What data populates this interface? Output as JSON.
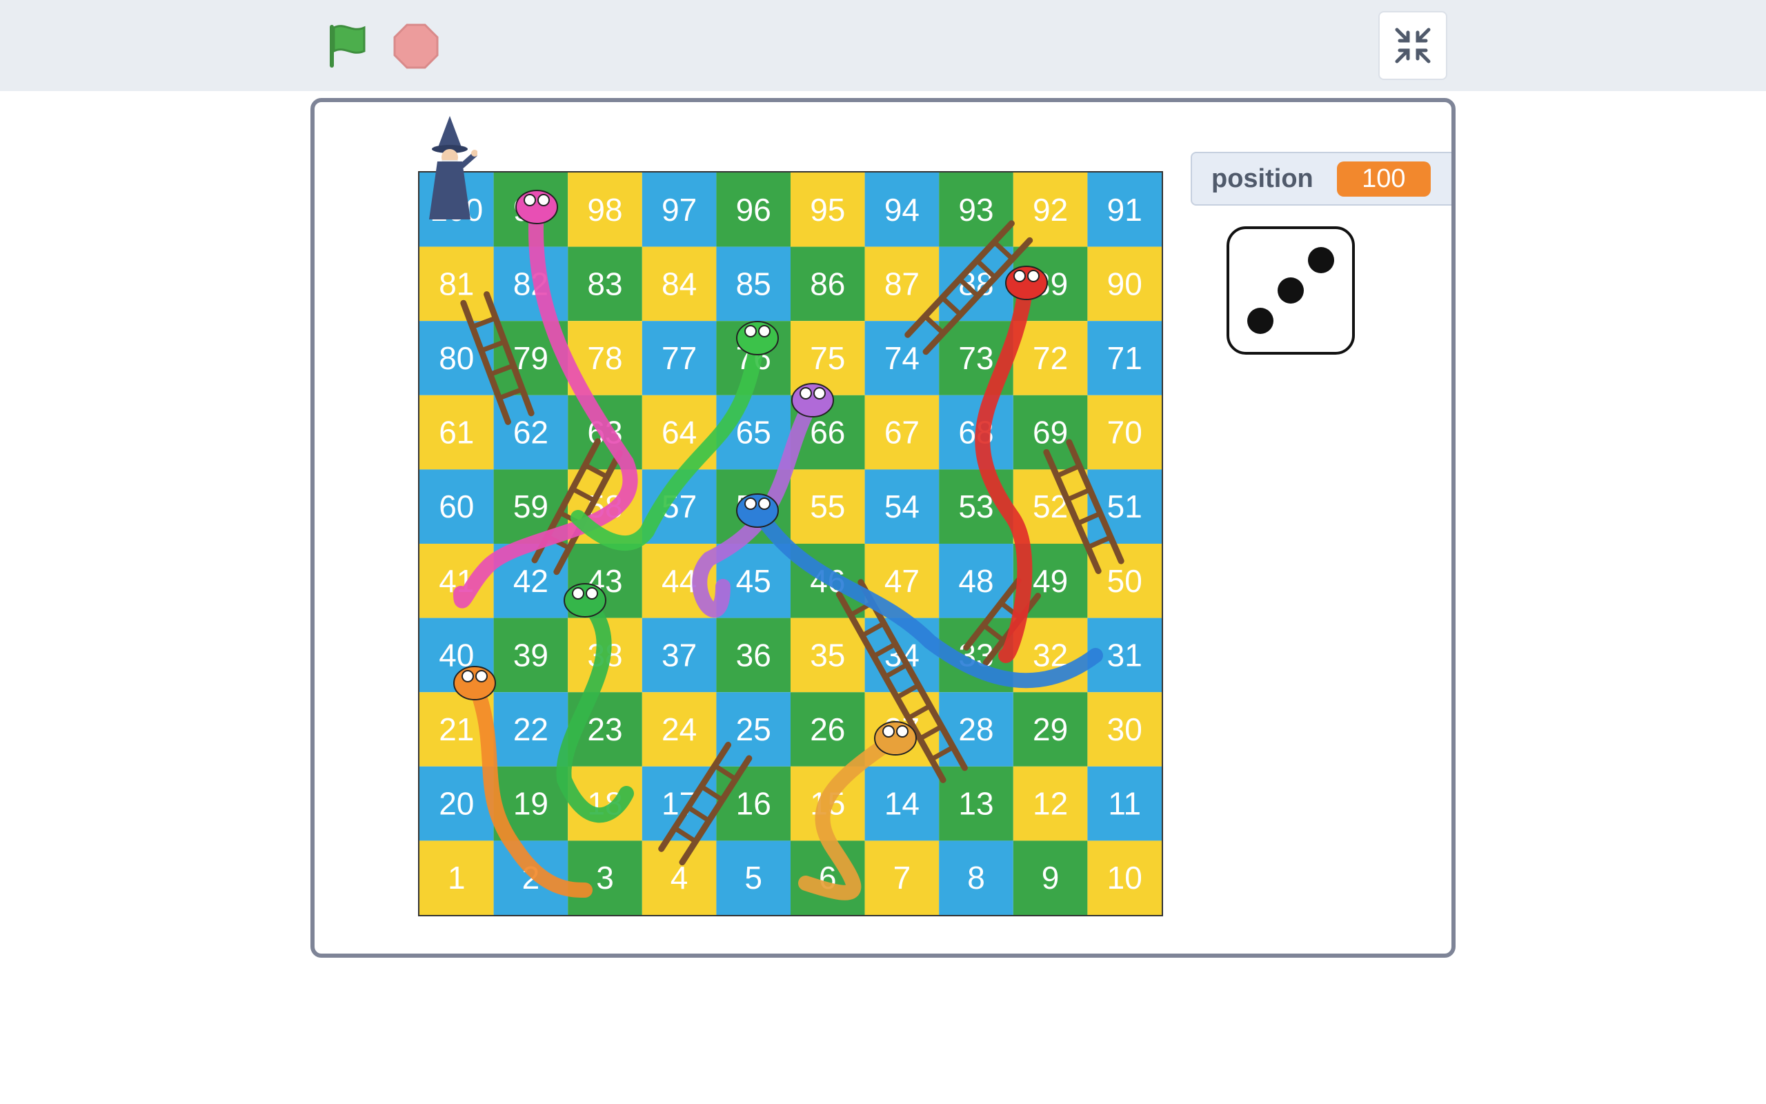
{
  "toolbar": {
    "green_flag_icon": "green-flag-icon",
    "stop_icon": "stop-sign-icon",
    "fullscreen_exit_icon": "shrink-arrows-icon",
    "flag_color": "#4cae4c",
    "stop_color": "#ec9c9c"
  },
  "stage": {
    "monitor": {
      "label": "position",
      "value": "100",
      "value_color": "#f2882d"
    },
    "dice": {
      "face": 3
    },
    "board": {
      "rows": [
        [
          "100",
          "99",
          "98",
          "97",
          "96",
          "95",
          "94",
          "93",
          "92",
          "91"
        ],
        [
          "81",
          "82",
          "83",
          "84",
          "85",
          "86",
          "87",
          "88",
          "89",
          "90"
        ],
        [
          "80",
          "79",
          "78",
          "77",
          "76",
          "75",
          "74",
          "73",
          "72",
          "71"
        ],
        [
          "61",
          "62",
          "63",
          "64",
          "65",
          "66",
          "67",
          "68",
          "69",
          "70"
        ],
        [
          "60",
          "59",
          "58",
          "57",
          "56",
          "55",
          "54",
          "53",
          "52",
          "51"
        ],
        [
          "41",
          "42",
          "43",
          "44",
          "45",
          "46",
          "47",
          "48",
          "49",
          "50"
        ],
        [
          "40",
          "39",
          "38",
          "37",
          "36",
          "35",
          "34",
          "33",
          "32",
          "31"
        ],
        [
          "21",
          "22",
          "23",
          "24",
          "25",
          "26",
          "27",
          "28",
          "29",
          "30"
        ],
        [
          "20",
          "19",
          "18",
          "17",
          "16",
          "15",
          "14",
          "13",
          "12",
          "11"
        ],
        [
          "1",
          "2",
          "3",
          "4",
          "5",
          "6",
          "7",
          "8",
          "9",
          "10"
        ]
      ],
      "palette": [
        "#37a9e1",
        "#ec6e24",
        "#3aa648",
        "#7b3fa0",
        "#f7d230",
        "#e7348c"
      ],
      "snake_colors": [
        "#e84fb4",
        "#3cc24a",
        "#b06ad8",
        "#e0302a",
        "#2d7fd8",
        "#35b64a",
        "#f28a2b",
        "#e8a13a"
      ],
      "ladder_color": "#7a4d2a",
      "player_icon": "wizard-icon"
    }
  }
}
